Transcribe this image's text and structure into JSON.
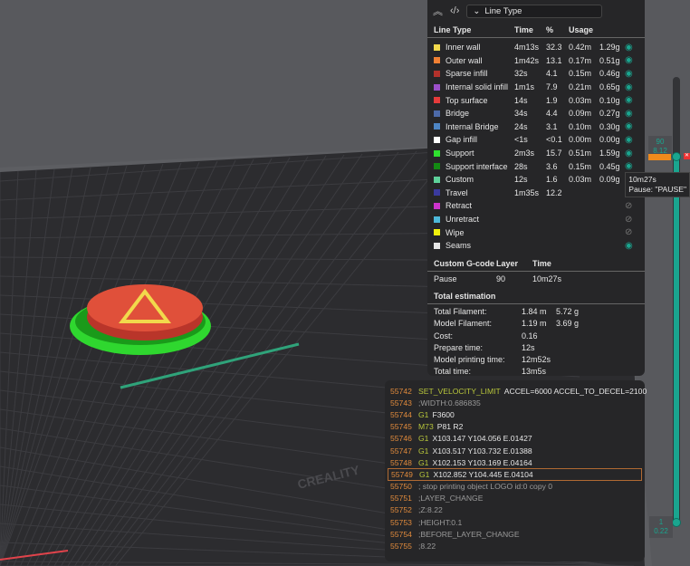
{
  "toolbar": {
    "view_label": "Line Type"
  },
  "legend": {
    "headers": {
      "type": "Line Type",
      "time": "Time",
      "pct": "%",
      "usage": "Usage"
    },
    "rows": [
      {
        "name": "Inner wall",
        "time": "4m13s",
        "pct": "32.3",
        "len": "0.42m",
        "weight": "1.29g",
        "color": "#f2d94c",
        "visible": true
      },
      {
        "name": "Outer wall",
        "time": "1m42s",
        "pct": "13.1",
        "len": "0.17m",
        "weight": "0.51g",
        "color": "#f08033",
        "visible": true
      },
      {
        "name": "Sparse infill",
        "time": "32s",
        "pct": "4.1",
        "len": "0.15m",
        "weight": "0.46g",
        "color": "#b3312b",
        "visible": true
      },
      {
        "name": "Internal solid infill",
        "time": "1m1s",
        "pct": "7.9",
        "len": "0.21m",
        "weight": "0.65g",
        "color": "#9b4fc9",
        "visible": true
      },
      {
        "name": "Top surface",
        "time": "14s",
        "pct": "1.9",
        "len": "0.03m",
        "weight": "0.10g",
        "color": "#e63b3b",
        "visible": true
      },
      {
        "name": "Bridge",
        "time": "34s",
        "pct": "4.4",
        "len": "0.09m",
        "weight": "0.27g",
        "color": "#4d6aa8",
        "visible": true
      },
      {
        "name": "Internal Bridge",
        "time": "24s",
        "pct": "3.1",
        "len": "0.10m",
        "weight": "0.30g",
        "color": "#4d85c4",
        "visible": true
      },
      {
        "name": "Gap infill",
        "time": "<1s",
        "pct": "<0.1",
        "len": "0.00m",
        "weight": "0.00g",
        "color": "#ffffff",
        "visible": true
      },
      {
        "name": "Support",
        "time": "2m3s",
        "pct": "15.7",
        "len": "0.51m",
        "weight": "1.59g",
        "color": "#2fe02f",
        "visible": true
      },
      {
        "name": "Support interface",
        "time": "28s",
        "pct": "3.6",
        "len": "0.15m",
        "weight": "0.45g",
        "color": "#138a13",
        "visible": true
      },
      {
        "name": "Custom",
        "time": "12s",
        "pct": "1.6",
        "len": "0.03m",
        "weight": "0.09g",
        "color": "#5ed19a",
        "visible": true
      },
      {
        "name": "Travel",
        "time": "1m35s",
        "pct": "12.2",
        "len": "",
        "weight": "",
        "color": "#3a3a9e",
        "visible": null
      },
      {
        "name": "Retract",
        "time": "",
        "pct": "",
        "len": "",
        "weight": "",
        "color": "#cc33cc",
        "visible": false
      },
      {
        "name": "Unretract",
        "time": "",
        "pct": "",
        "len": "",
        "weight": "",
        "color": "#4db8d9",
        "visible": false
      },
      {
        "name": "Wipe",
        "time": "",
        "pct": "",
        "len": "",
        "weight": "",
        "color": "#f2f20d",
        "visible": false
      },
      {
        "name": "Seams",
        "time": "",
        "pct": "",
        "len": "",
        "weight": "",
        "color": "#e6e6e6",
        "visible": true
      }
    ]
  },
  "custom_gcode": {
    "headers": {
      "name": "Custom G-code",
      "layer": "Layer",
      "time": "Time"
    },
    "rows": [
      {
        "name": "Pause",
        "layer": "90",
        "time": "10m27s"
      }
    ]
  },
  "estimation": {
    "title": "Total estimation",
    "rows": [
      {
        "k": "Total Filament:",
        "v": "1.84 m",
        "w": "5.72 g"
      },
      {
        "k": "Model Filament:",
        "v": "1.19 m",
        "w": "3.69 g"
      },
      {
        "k": "Cost:",
        "v": "0.16",
        "w": ""
      },
      {
        "k": "Prepare time:",
        "v": "12s",
        "w": ""
      },
      {
        "k": "Model printing time:",
        "v": "12m52s",
        "w": ""
      },
      {
        "k": "Total time:",
        "v": "13m5s",
        "w": ""
      }
    ]
  },
  "gcode": [
    {
      "n": "55742",
      "cmd": "SET_VELOCITY_LIMIT",
      "args": "ACCEL=6000 ACCEL_TO_DECEL=2100"
    },
    {
      "n": "55743",
      "cmd": "",
      "args": ";WIDTH:0.686835",
      "comment": true
    },
    {
      "n": "55744",
      "cmd": "G1",
      "args": "F3600"
    },
    {
      "n": "55745",
      "cmd": "M73",
      "args": "P81 R2"
    },
    {
      "n": "55746",
      "cmd": "G1",
      "args": "X103.147 Y104.056 E.01427"
    },
    {
      "n": "55747",
      "cmd": "G1",
      "args": "X103.517 Y103.732 E.01388"
    },
    {
      "n": "55748",
      "cmd": "G1",
      "args": "X102.153 Y103.169 E.04164"
    },
    {
      "n": "55749",
      "cmd": "G1",
      "args": "X102.852 Y104.445 E.04104",
      "highlight": true
    },
    {
      "n": "55750",
      "cmd": "",
      "args": "; stop printing object LOGO id:0 copy 0",
      "comment": true
    },
    {
      "n": "55751",
      "cmd": "",
      "args": ";LAYER_CHANGE",
      "comment": true
    },
    {
      "n": "55752",
      "cmd": "",
      "args": ";Z:8.22",
      "comment": true
    },
    {
      "n": "55753",
      "cmd": "",
      "args": ";HEIGHT:0.1",
      "comment": true
    },
    {
      "n": "55754",
      "cmd": "",
      "args": ";BEFORE_LAYER_CHANGE",
      "comment": true
    },
    {
      "n": "55755",
      "cmd": "",
      "args": ";8.22",
      "comment": true
    }
  ],
  "slider": {
    "top_layer": "90",
    "top_height": "8.12",
    "bottom_layer": "1",
    "bottom_height": "0.22",
    "tooltip_time": "10m27s",
    "tooltip_text": "Pause: \"PAUSE\""
  },
  "bed": {
    "brand": "CREALITY"
  }
}
